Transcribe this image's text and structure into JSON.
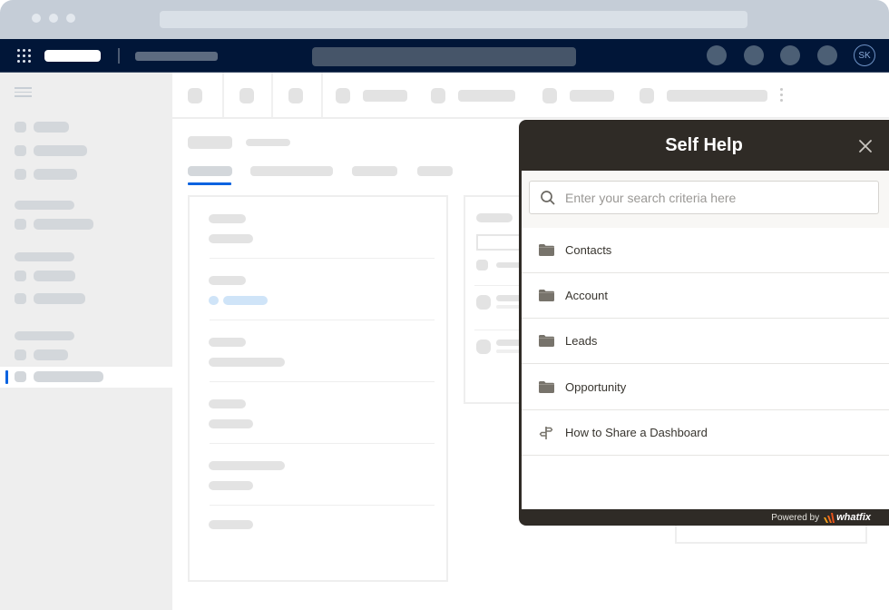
{
  "header": {
    "avatar_initials": "SK"
  },
  "self_help": {
    "title": "Self Help",
    "search": {
      "placeholder": "Enter your search criteria here",
      "value": ""
    },
    "items": [
      {
        "label": "Contacts",
        "icon": "folder-icon"
      },
      {
        "label": "Account",
        "icon": "folder-icon"
      },
      {
        "label": "Leads",
        "icon": "folder-icon"
      },
      {
        "label": "Opportunity",
        "icon": "folder-icon"
      },
      {
        "label": "How to Share a Dashboard",
        "icon": "signpost-icon"
      }
    ],
    "footer": {
      "powered_by": "Powered by",
      "brand": "whatfix"
    }
  },
  "colors": {
    "widget_dark": "#2f2b26",
    "app_header": "#011638",
    "accent_blue": "#0b63e0",
    "brand_orange": "#f26b1d"
  }
}
